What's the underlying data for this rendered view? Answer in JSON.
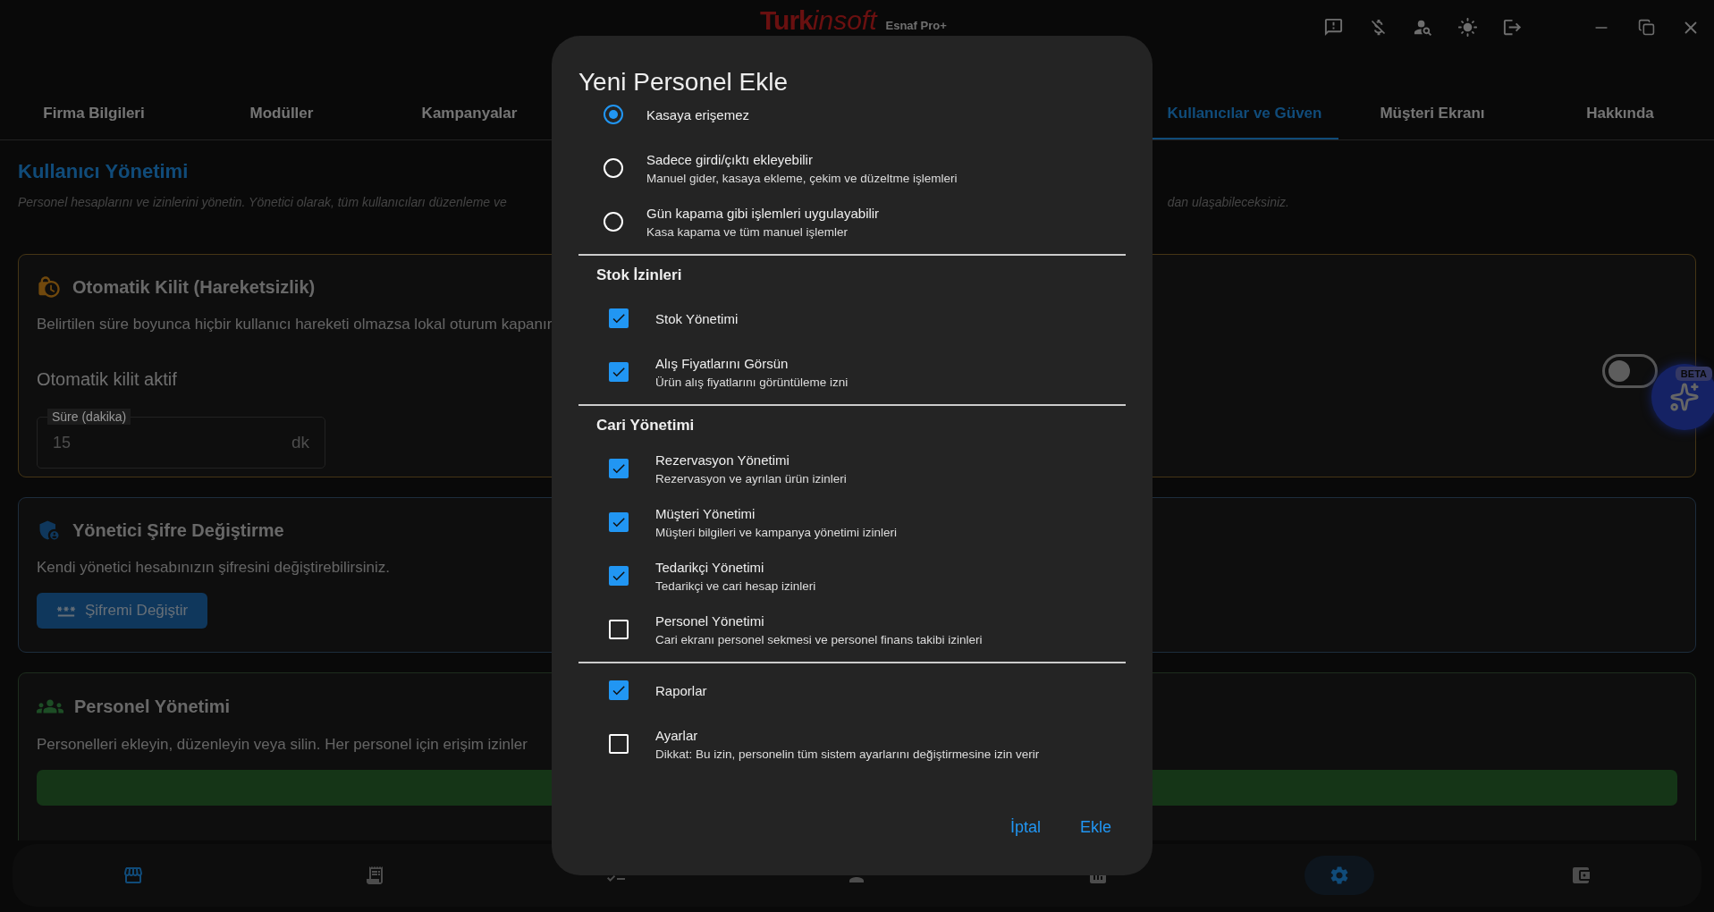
{
  "app": {
    "brand_main": "Turk",
    "brand_accent": "insoft",
    "edition": "Esnaf Pro+"
  },
  "tabs_left": [
    {
      "label": "Firma Bilgileri",
      "selected": false
    },
    {
      "label": "Modüller",
      "selected": false
    },
    {
      "label": "Kampanyalar",
      "selected": false
    }
  ],
  "tabs_right": [
    {
      "label": "Kullanıcılar ve Güven",
      "selected": true
    },
    {
      "label": "Müşteri Ekranı",
      "selected": false
    },
    {
      "label": "Hakkında",
      "selected": false
    }
  ],
  "page": {
    "title": "Kullanıcı Yönetimi",
    "intro_start": "Personel hesaplarını ve izinlerini yönetin. Yönetici olarak, tüm kullanıcıları düzenleme ve",
    "intro_end": "dan ulaşabileceksiniz."
  },
  "auto_lock": {
    "title": "Otomatik Kilit (Hareketsizlik)",
    "description": "Belirtilen süre boyunca hiçbir kullanıcı hareketi olmazsa lokal oturum kapanır",
    "toggle_label": "Otomatik kilit aktif",
    "on": false,
    "field": {
      "label": "Süre (dakika)",
      "value": "15",
      "suffix": "dk",
      "disabled": true
    }
  },
  "admin_password": {
    "title": "Yönetici Şifre Değiştirme",
    "description": "Kendi yönetici hesabınızın şifresini değiştirebilirsiniz.",
    "button": "Şifremi Değiştir"
  },
  "staff": {
    "title": "Personel Yönetimi",
    "description": "Personelleri ekleyin, düzenleyin veya silin. Her personel için erişim izinler"
  },
  "assistant": {
    "badge": "BETA"
  },
  "bottom_nav": [
    {
      "selected": false,
      "highlighted": true
    },
    {
      "selected": false,
      "highlighted": false
    },
    {
      "selected": false,
      "highlighted": false
    },
    {
      "selected": false,
      "highlighted": false
    },
    {
      "selected": false,
      "highlighted": false
    },
    {
      "selected": true,
      "highlighted": true
    },
    {
      "selected": false,
      "highlighted": false
    }
  ],
  "dialog": {
    "title": "Yeni Personel Ekle",
    "sections": [
      {
        "kind": "radio",
        "items": [
          {
            "label": "Kasaya erişemez",
            "selected": true
          },
          {
            "label": "Sadece girdi/çıktı ekleyebilir",
            "description": "Manuel gider, kasaya ekleme, çekim ve düzeltme işlemleri",
            "selected": false
          },
          {
            "label": "Gün kapama gibi işlemleri uygulayabilir",
            "description": "Kasa kapama ve tüm manuel işlemler",
            "selected": false
          }
        ]
      },
      {
        "kind": "checkbox",
        "heading": "Stok İzinleri",
        "items": [
          {
            "label": "Stok Yönetimi",
            "checked": true
          },
          {
            "label": "Alış Fiyatlarını Görsün",
            "description": "Ürün alış fiyatlarını görüntüleme izni",
            "checked": true
          }
        ]
      },
      {
        "kind": "checkbox",
        "heading": "Cari Yönetimi",
        "items": [
          {
            "label": "Rezervasyon Yönetimi",
            "description": "Rezervasyon ve ayrılan ürün izinleri",
            "checked": true
          },
          {
            "label": "Müşteri Yönetimi",
            "description": "Müşteri bilgileri ve kampanya yönetimi izinleri",
            "checked": true
          },
          {
            "label": "Tedarikçi Yönetimi",
            "description": "Tedarikçi ve cari hesap izinleri",
            "checked": true
          },
          {
            "label": "Personel Yönetimi",
            "description": "Cari ekranı personel sekmesi ve personel finans takibi izinleri",
            "checked": false
          }
        ]
      },
      {
        "kind": "checkbox",
        "items": [
          {
            "label": "Raporlar",
            "checked": true
          },
          {
            "label": "Ayarlar",
            "description": "Dikkat: Bu izin, personelin tüm sistem ayarlarını değiştirmesine izin verir",
            "checked": false
          }
        ]
      }
    ],
    "buttons": [
      "İptal",
      "Ekle"
    ]
  }
}
